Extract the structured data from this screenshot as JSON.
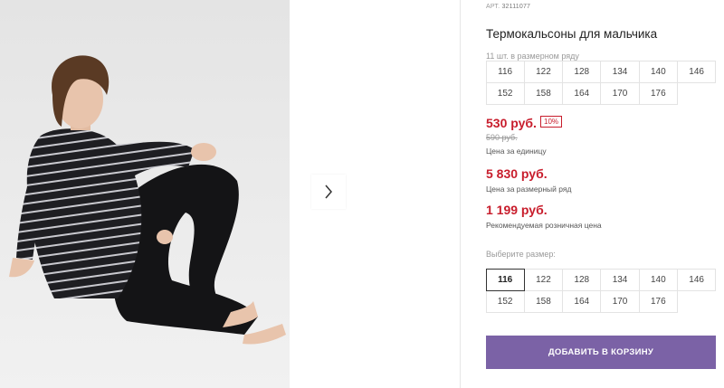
{
  "product": {
    "art_label": "АРТ.",
    "art_number": "32111077",
    "title": "Термокальсоны для мальчика",
    "size_row_note": "11 шт. в размерном ряду",
    "size_row": [
      "116",
      "122",
      "128",
      "134",
      "140",
      "146",
      "152",
      "158",
      "164",
      "170",
      "176"
    ]
  },
  "pricing": {
    "unit_price": "530 руб.",
    "discount": "10%",
    "old_price": "590 руб.",
    "unit_label": "Цена за единицу",
    "row_price": "5 830 руб.",
    "row_label": "Цена за размерный ряд",
    "retail_price": "1 199 руб.",
    "retail_label": "Рекомендуемая розничная цена",
    "accent_color": "#c81d2c"
  },
  "size_select": {
    "label": "Выберите размер:",
    "selected": "116",
    "options": [
      "116",
      "122",
      "128",
      "134",
      "140",
      "146",
      "152",
      "158",
      "164",
      "170",
      "176"
    ]
  },
  "cart": {
    "button_label": "ДОБАВИТЬ В КОРЗИНУ",
    "button_color": "#7b62a6"
  },
  "gallery": {
    "next_icon": "chevron-right-icon"
  }
}
